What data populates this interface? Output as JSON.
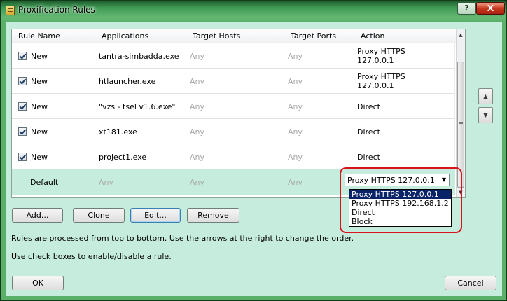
{
  "window": {
    "title": "Proxification Rules"
  },
  "title_buttons": {
    "help": "?",
    "close": "X"
  },
  "columns": [
    "Rule Name",
    "Applications",
    "Target Hosts",
    "Target Ports",
    "Action"
  ],
  "rules": [
    {
      "name": "New",
      "application": "tantra-simbadda.exe",
      "hosts": "Any",
      "ports": "Any",
      "action": "Proxy HTTPS\n127.0.0.1",
      "checked": true
    },
    {
      "name": "New",
      "application": "htlauncher.exe",
      "hosts": "Any",
      "ports": "Any",
      "action": "Proxy HTTPS\n127.0.0.1",
      "checked": true
    },
    {
      "name": "New",
      "application": "\"vzs - tsel v1.6.exe\"",
      "hosts": "Any",
      "ports": "Any",
      "action": "Direct",
      "checked": true
    },
    {
      "name": "New",
      "application": "xt181.exe",
      "hosts": "Any",
      "ports": "Any",
      "action": "Direct",
      "checked": true
    },
    {
      "name": "New",
      "application": "project1.exe",
      "hosts": "Any",
      "ports": "Any",
      "action": "Direct",
      "checked": true
    }
  ],
  "default_rule": {
    "name": "Default",
    "application": "Any",
    "hosts": "Any",
    "ports": "Any"
  },
  "action_combo": {
    "value": "Proxy HTTPS 127.0.0.1",
    "options": [
      "Proxy HTTPS 127.0.0.1",
      "Proxy HTTPS 192.168.1.2",
      "Direct",
      "Block"
    ],
    "selected_index": 0
  },
  "buttons": {
    "add": "Add...",
    "clone": "Clone",
    "edit": "Edit...",
    "remove": "Remove",
    "ok": "OK",
    "cancel": "Cancel"
  },
  "help": {
    "line1": "Rules are processed from top to bottom. Use the arrows at the right to change the order.",
    "line2": "Use check boxes to enable/disable a rule."
  },
  "colors": {
    "client_bg": "#c5ecdc",
    "highlight": "#d8141a",
    "selection": "#0a246a"
  }
}
